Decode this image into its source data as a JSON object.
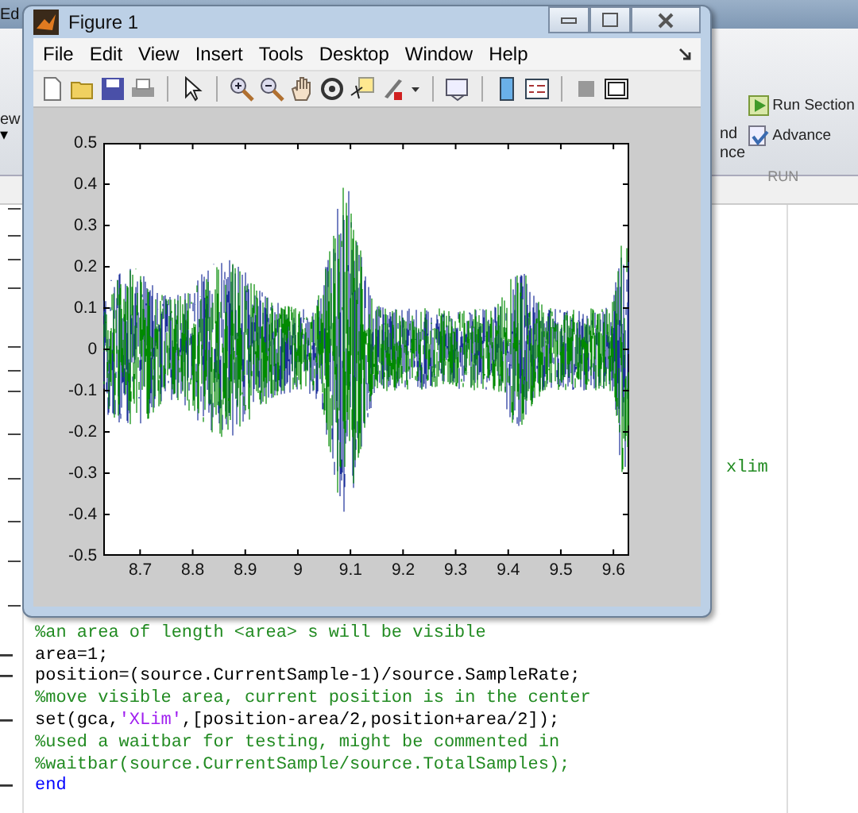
{
  "editor_tab": {
    "label": "Ed"
  },
  "ribbon": {
    "left_label": "ew",
    "left_caret": "▾",
    "partial_labels": [
      "nd",
      "nce"
    ],
    "run_buttons": [
      {
        "label": "Run Section",
        "kind": "run"
      },
      {
        "label": "Advance",
        "kind": "advance"
      }
    ],
    "group_label": "RUN"
  },
  "editor": {
    "tail_text": "xlim",
    "lines": [
      {
        "breakpoint": false,
        "segments": [
          {
            "kind": "comment",
            "text": "%an area of length <area> s will be visible"
          }
        ]
      },
      {
        "breakpoint": true,
        "segments": [
          {
            "kind": "plain",
            "text": "area=1;"
          }
        ]
      },
      {
        "breakpoint": true,
        "segments": [
          {
            "kind": "plain",
            "text": "position=(source.CurrentSample-1)/source.SampleRate;"
          }
        ]
      },
      {
        "breakpoint": false,
        "segments": [
          {
            "kind": "comment",
            "text": "%move visible area, current position is in the center"
          }
        ]
      },
      {
        "breakpoint": true,
        "segments": [
          {
            "kind": "plain",
            "text": "set(gca,"
          },
          {
            "kind": "string",
            "text": "'XLim'"
          },
          {
            "kind": "plain",
            "text": ",[position-area/2,position+area/2]);"
          }
        ]
      },
      {
        "breakpoint": false,
        "segments": [
          {
            "kind": "comment",
            "text": "%used a waitbar for testing, might be commented in"
          }
        ]
      },
      {
        "breakpoint": false,
        "segments": [
          {
            "kind": "comment",
            "text": "%waitbar(source.CurrentSample/source.TotalSamples);"
          }
        ]
      },
      {
        "breakpoint": true,
        "segments": [
          {
            "kind": "keyword",
            "text": "end"
          }
        ]
      }
    ]
  },
  "figure": {
    "title": "Figure 1",
    "menu": [
      "File",
      "Edit",
      "View",
      "Insert",
      "Tools",
      "Desktop",
      "Window",
      "Help"
    ],
    "plot": {
      "yticks": [
        "0.5",
        "0.4",
        "0.3",
        "0.2",
        "0.1",
        "0",
        "-0.1",
        "-0.2",
        "-0.3",
        "-0.4",
        "-0.5"
      ],
      "xticks": [
        "8.7",
        "8.8",
        "8.9",
        "9",
        "9.1",
        "9.2",
        "9.3",
        "9.4",
        "9.5",
        "9.6"
      ]
    }
  }
}
